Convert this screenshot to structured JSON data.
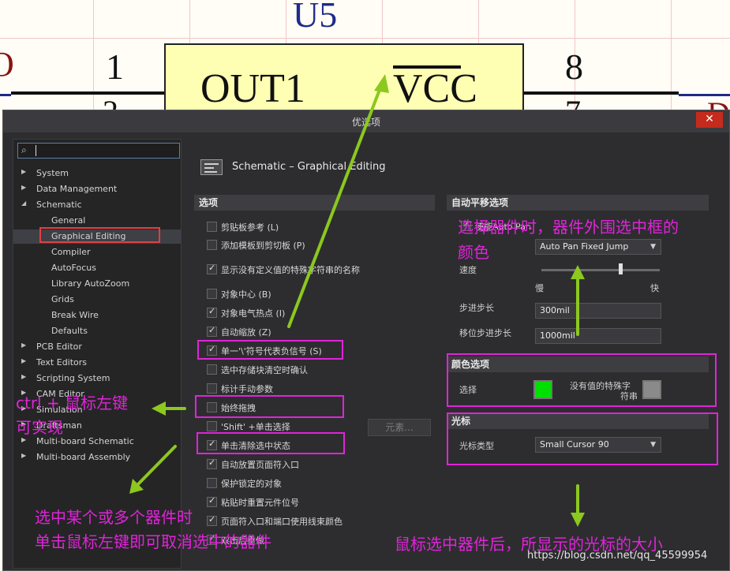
{
  "schematic": {
    "component": "U5",
    "pin_left_top": "1",
    "pin_left_bottom": "2",
    "pin_right_top": "8",
    "pin_right_bottom": "7",
    "pin_name_left": "OUT1",
    "pin_name_right": "VCC"
  },
  "dialog": {
    "title": "优选项",
    "close_label": "✕",
    "search_value": "",
    "page_header": "Schematic – Graphical Editing",
    "tree": [
      {
        "label": "System",
        "arrow": "▶"
      },
      {
        "label": "Data Management",
        "arrow": "▶"
      },
      {
        "label": "Schematic",
        "arrow": "◢"
      },
      {
        "label": "General",
        "arrow": ""
      },
      {
        "label": "Graphical Editing",
        "arrow": ""
      },
      {
        "label": "Compiler",
        "arrow": ""
      },
      {
        "label": "AutoFocus",
        "arrow": ""
      },
      {
        "label": "Library AutoZoom",
        "arrow": ""
      },
      {
        "label": "Grids",
        "arrow": ""
      },
      {
        "label": "Break Wire",
        "arrow": ""
      },
      {
        "label": "Defaults",
        "arrow": ""
      },
      {
        "label": "PCB Editor",
        "arrow": "▶"
      },
      {
        "label": "Text Editors",
        "arrow": "▶"
      },
      {
        "label": "Scripting System",
        "arrow": "▶"
      },
      {
        "label": "CAM Editor",
        "arrow": "▶"
      },
      {
        "label": "Simulation",
        "arrow": "▶"
      },
      {
        "label": "Draftsman",
        "arrow": "▶"
      },
      {
        "label": "Multi-board Schematic",
        "arrow": "▶"
      },
      {
        "label": "Multi-board Assembly",
        "arrow": "▶"
      }
    ],
    "options_header": "选项",
    "options": [
      {
        "label": "剪贴板参考 (L)",
        "checked": false
      },
      {
        "label": "添加模板到剪切板 (P)",
        "checked": false
      },
      {
        "label": "显示没有定义值的特殊字符串的名称",
        "checked": true
      },
      {
        "label": "对象中心 (B)",
        "checked": false
      },
      {
        "label": "对象电气热点 (I)",
        "checked": true
      },
      {
        "label": "自动缩放 (Z)",
        "checked": true
      },
      {
        "label": "单一'\\'符号代表负信号 (S)",
        "checked": true
      },
      {
        "label": "选中存储块清空时确认",
        "checked": false
      },
      {
        "label": "标计手动参数",
        "checked": false
      },
      {
        "label": "始终拖拽",
        "checked": false
      },
      {
        "label": "'Shift' +单击选择",
        "checked": false
      },
      {
        "label": "单击清除选中状态",
        "checked": true
      },
      {
        "label": "自动放置页面符入口",
        "checked": true
      },
      {
        "label": "保护锁定的对象",
        "checked": false
      },
      {
        "label": "粘贴时重置元件位号",
        "checked": true
      },
      {
        "label": "页面符入口和端口使用线束颜色",
        "checked": true
      },
      {
        "label": "双击后重做",
        "checked": true
      }
    ],
    "elements_button": "元素...",
    "autopan_header": "自动平移选项",
    "autopan_enable_label": "使能Auto Pan",
    "style_value": "Auto Pan Fixed Jump",
    "speed_label": "速度",
    "slow_label": "慢",
    "fast_label": "快",
    "speed_level": 0.65,
    "step_label": "步进步长",
    "step_value": "300mil",
    "shift_step_label": "移位步进步长",
    "shift_step_value": "1000mil",
    "color_header": "颜色选项",
    "selection_label": "选择",
    "selection_color": "#00e000",
    "nodef_label_line1": "没有值的特殊字",
    "nodef_label_line2": "符串",
    "nodef_color": "#8a8a8a",
    "cursor_header": "光标",
    "cursor_type_label": "光标类型",
    "cursor_type_value": "Small Cursor 90"
  },
  "annotations": {
    "select_color_line1": "选择器件时，器件外围选中框的",
    "select_color_line2": "颜色",
    "ctrl_line1": "ctrl + 鼠标左键",
    "ctrl_line2": "可实现",
    "deselect_line1": "选中某个或多个器件时",
    "deselect_line2": "单击鼠标左键即可取消选中的器件",
    "cursor_desc": "鼠标选中器件后，所显示的光标的大小",
    "accent_color": "#e024d8",
    "arrow_color": "#8cc81e"
  },
  "watermark": "https://blog.csdn.net/qq_45599954"
}
